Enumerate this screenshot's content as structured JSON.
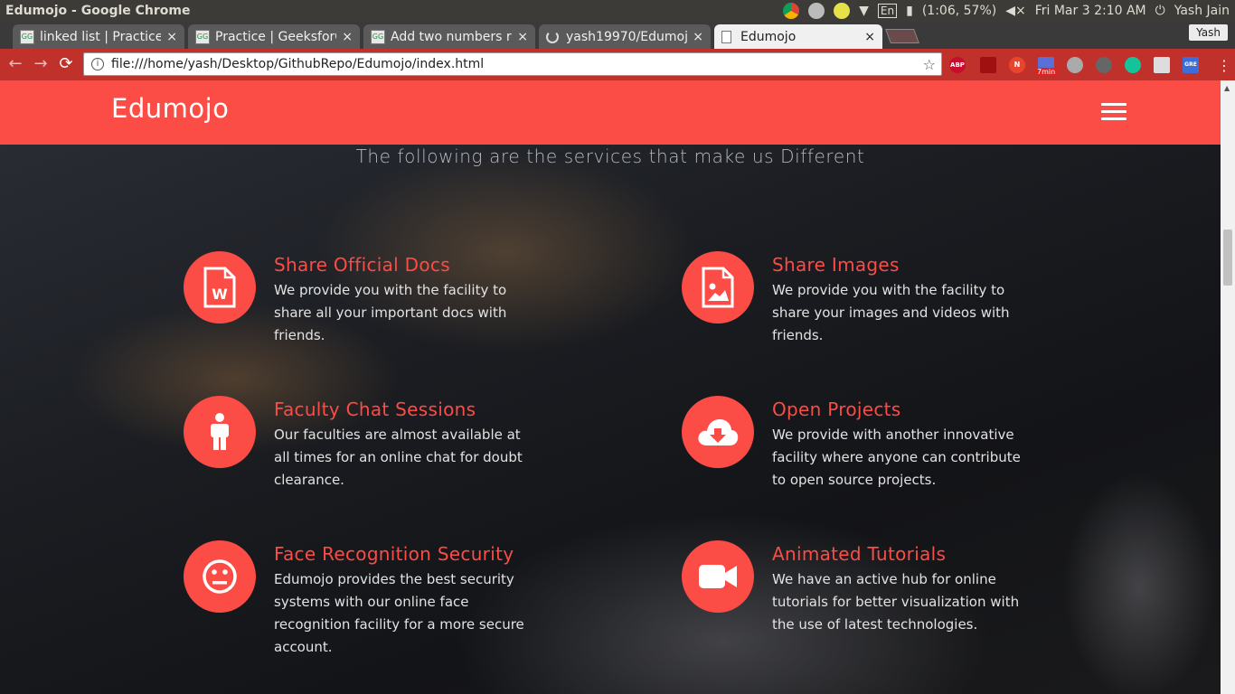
{
  "os": {
    "window_title": "Edumojo - Google Chrome",
    "battery": "(1:06, 57%)",
    "datetime": "Fri Mar  3  2:10 AM",
    "user": "Yash Jain",
    "keyboard": "En"
  },
  "tabs": [
    {
      "label": "linked list | Practice",
      "close": "×"
    },
    {
      "label": "Practice | GeeksforG",
      "close": "×"
    },
    {
      "label": "Add two numbers r",
      "close": "×"
    },
    {
      "label": "yash19970/Edumoj",
      "close": "×"
    },
    {
      "label": "Edumojo",
      "close": "×"
    }
  ],
  "profile_name": "Yash",
  "toolbar": {
    "url": "file:///home/yash/Desktop/GithubRepo/Edumojo/index.html",
    "back": "←",
    "forward": "→",
    "reload": "⟳",
    "star": "☆",
    "ext_abp": "ABP",
    "ext_timer": "7min"
  },
  "site": {
    "brand": "Edumojo",
    "subtitle": "The following are the services that make us Different",
    "accent_color": "#fb4c46"
  },
  "services": [
    {
      "title": "Share Official Docs",
      "desc": "We provide you with the facility to share all your important docs with friends.",
      "icon": "word-doc-icon"
    },
    {
      "title": "Share Images",
      "desc": "We provide you with the facility to share your images and videos with friends.",
      "icon": "image-file-icon"
    },
    {
      "title": "Faculty Chat Sessions",
      "desc": "Our faculties are almost available at all times for an online chat for doubt clearance.",
      "icon": "person-icon"
    },
    {
      "title": "Open Projects",
      "desc": "We provide with another innovative facility where anyone can contribute to open source projects.",
      "icon": "cloud-download-icon"
    },
    {
      "title": "Face Recognition Security",
      "desc": "Edumojo provides the best security systems with our online face recognition facility for a more secure account.",
      "icon": "neutral-face-icon"
    },
    {
      "title": "Animated Tutorials",
      "desc": "We have an active hub for online tutorials for better visualization with the use of latest technologies.",
      "icon": "video-camera-icon"
    }
  ]
}
